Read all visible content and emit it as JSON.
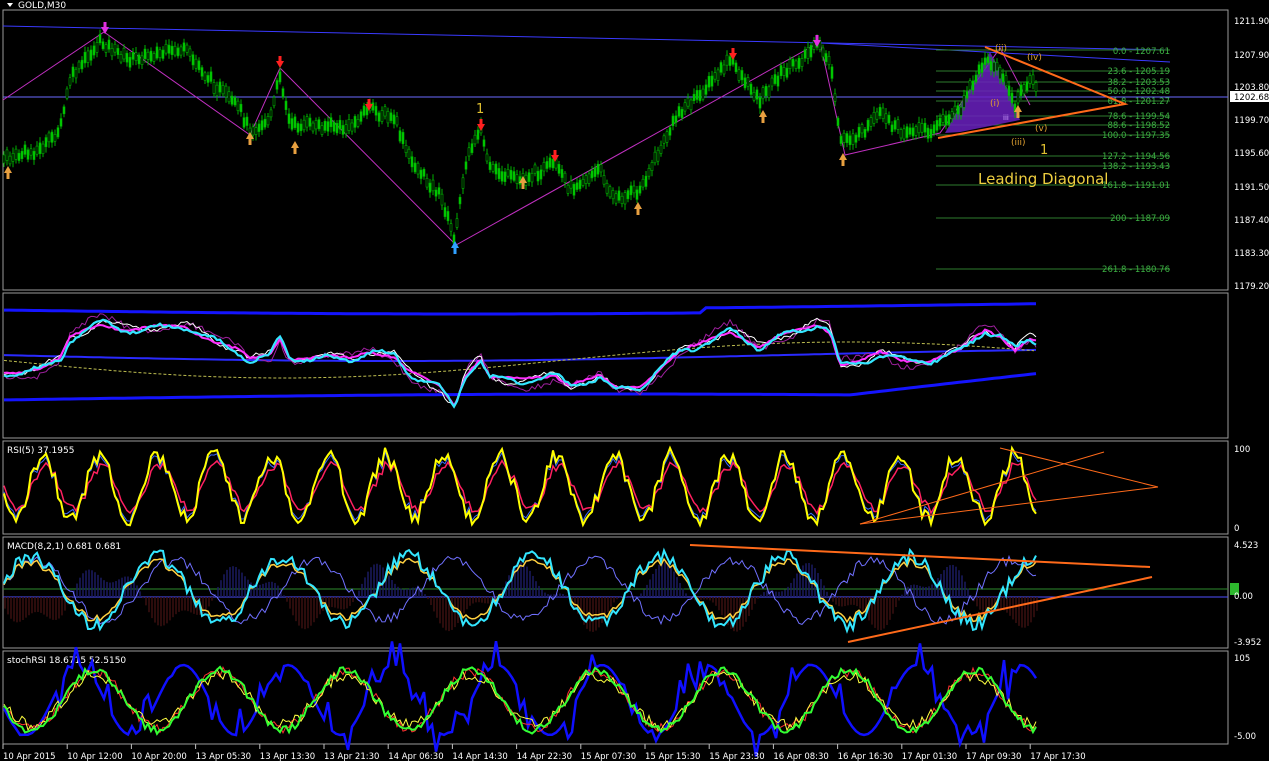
{
  "window": {
    "title": "GOLD,M30"
  },
  "panes": {
    "rsi_label": "RSI(5) 37.1955",
    "macd_label": "MACD(8,2,1) 0.681 0.681",
    "stoch_label": "stochRSI 18.6715 52.5150"
  },
  "price_axis": {
    "labels": [
      "1211.90",
      "1207.90",
      "1203.80",
      "1202.68",
      "1199.70",
      "1195.60",
      "1191.50",
      "1187.40",
      "1183.30",
      "1179.20"
    ],
    "current": "1202.68"
  },
  "rsi_axis": {
    "top": "100",
    "bottom": "0"
  },
  "macd_axis": {
    "top": "4.523",
    "mid": "0.00",
    "bottom": "-3.952"
  },
  "stoch_axis": {
    "top": "105",
    "bottom": "-5.00"
  },
  "fib_levels": [
    {
      "label": "0.0 - 1207.61"
    },
    {
      "label": "23.6 - 1205.19"
    },
    {
      "label": "38.2 - 1203.53"
    },
    {
      "label": "50.0 - 1202.48"
    },
    {
      "label": "61.8 - 1201.27"
    },
    {
      "label": "78.6 - 1199.54"
    },
    {
      "label": "88.6 - 1198.52"
    },
    {
      "label": "100.0 - 1197.35"
    },
    {
      "label": "127.2 - 1194.56"
    },
    {
      "label": "138.2 - 1193.43"
    },
    {
      "label": "161.8 - 1191.01"
    },
    {
      "label": "200 - 1187.09"
    },
    {
      "label": "261.8 - 1180.76"
    }
  ],
  "annotations": {
    "leading_diagonal": "Leading Diagonal",
    "wave_1_top": "1",
    "wave_1_right": "1",
    "wave_ii": "(ii)",
    "wave_iv": "(iv)",
    "wave_i": "(i)",
    "wave_iii": "(iii)",
    "wave_v": "(v)",
    "wave_iii_small": "iii"
  },
  "time_axis": {
    "labels": [
      "10 Apr 2015",
      "10 Apr 12:00",
      "10 Apr 20:00",
      "13 Apr 05:30",
      "13 Apr 13:30",
      "13 Apr 21:30",
      "14 Apr 06:30",
      "14 Apr 14:30",
      "14 Apr 22:30",
      "15 Apr 07:30",
      "15 Apr 15:30",
      "15 Apr 23:30",
      "16 Apr 08:30",
      "16 Apr 16:30",
      "17 Apr 01:30",
      "17 Apr 09:30",
      "17 Apr 17:30"
    ]
  },
  "colors": {
    "background": "#000000",
    "bull_candle": "#00c000",
    "grid_border": "#c0c0c0",
    "channel_line": "#4040ff",
    "triangle": "#ff6a1a",
    "fib_line": "#2e8b2e",
    "rsi_line": "#ffff00",
    "macd_line": "#33e6ff",
    "stoch_line": "#33ff33"
  }
}
